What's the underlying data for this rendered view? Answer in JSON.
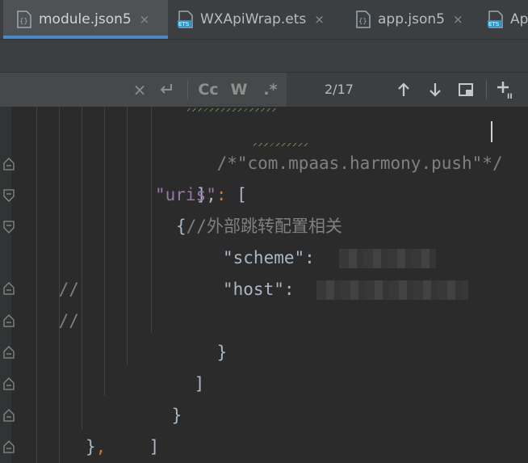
{
  "tabs": [
    {
      "label": "module.json5",
      "close": "×",
      "active": true,
      "icon": "json-file-icon"
    },
    {
      "label": "WXApiWrap.ets",
      "close": "×",
      "active": false,
      "icon": "ets-file-icon"
    },
    {
      "label": "app.json5",
      "close": "×",
      "active": false,
      "icon": "json-file-icon"
    },
    {
      "label": "Ap",
      "active": false,
      "icon": "ets-file-icon"
    }
  ],
  "find_bar": {
    "clear": "×",
    "match_case": "Cc",
    "words": "W",
    "regex": ".*",
    "counter": "2/17",
    "prev": "↑",
    "next": "↓"
  },
  "code": {
    "line1": "/*\"com.mpaas.harmony.push\"*/",
    "line2": "],",
    "line3_key": "\"uris\"",
    "line3_colon": ": ",
    "line3_bracket": "[",
    "line4_brace": "{",
    "line4_comment": "//外部跳转配置相关",
    "line5_prefix": "//",
    "line5_key": "\"scheme\"",
    "line5_colon": ": ",
    "line6_prefix": "//",
    "line6_key": "\"host\"",
    "line6_colon": ": ",
    "line7": "}",
    "line8": "]",
    "line9": "}",
    "line10": "]",
    "line11_brace": "}",
    "line11_comma": ","
  },
  "colors": {
    "background": "#2b2b2b",
    "tab_accent": "#4a88c7",
    "string": "#6a8759",
    "key": "#9876aa",
    "comment": "#808080",
    "punctuation": "#cc7832"
  }
}
